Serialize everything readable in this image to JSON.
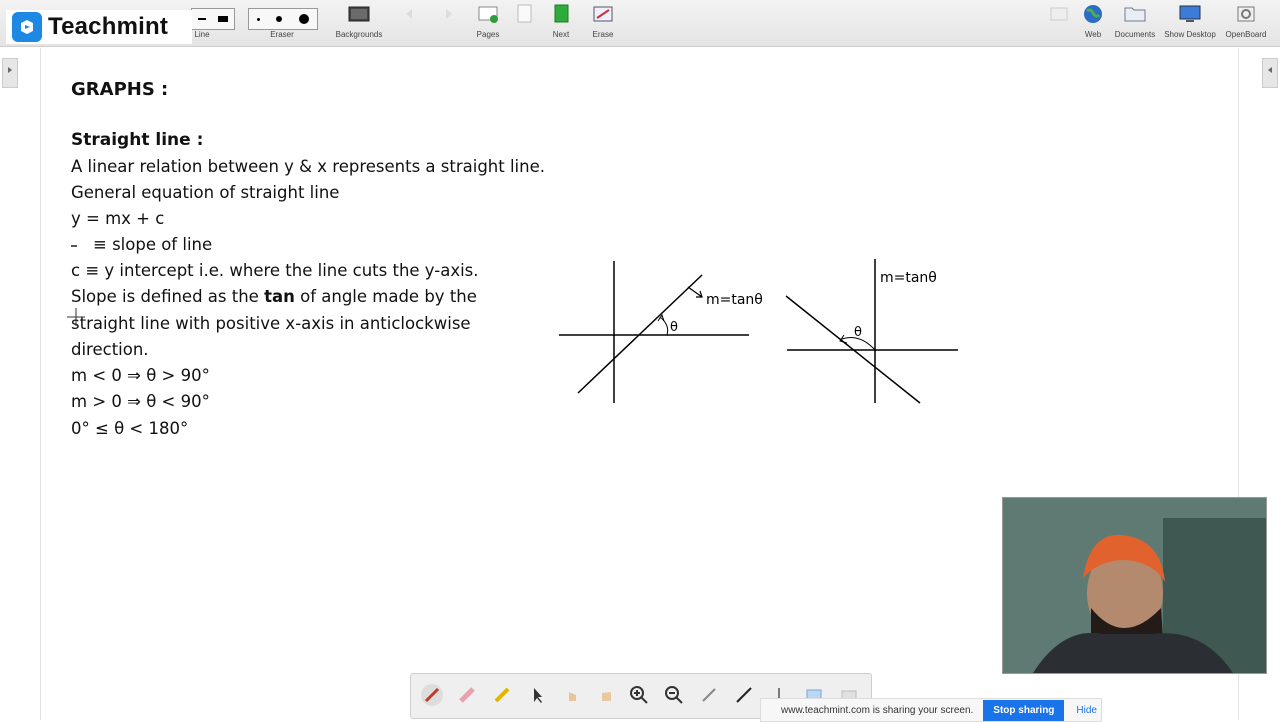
{
  "brand": {
    "name": "Teachmint"
  },
  "toolbar": {
    "line_label": "Line",
    "eraser_label": "Eraser",
    "backgrounds_label": "Backgrounds",
    "pages_label": "Pages",
    "next_label": "Next",
    "erase_label": "Erase",
    "web_label": "Web",
    "documents_label": "Documents",
    "show_desktop_label": "Show Desktop",
    "openboard_label": "OpenBoard"
  },
  "notes": {
    "heading": "GRAPHS  :",
    "subheading": "Straight line :",
    "line1": "A linear relation between y & x represents a straight line.",
    "line2": "General equation of straight line",
    "line3": "y = mx + c",
    "line4": "≡ slope of line",
    "line5": "c ≡ y intercept i.e. where the line cuts the y-axis.",
    "line6_a": "Slope is defined as the ",
    "line6_b": "tan",
    "line6_c": " of  angle made by the",
    "line7": "straight line with positive x-axis in anticlockwise",
    "line8": "direction.",
    "line9": "m < 0  ⇒  θ > 90°",
    "line10": "m > 0  ⇒ θ < 90°",
    "line11": "0° ≤ θ < 180°"
  },
  "graph1": {
    "label": "m=tanθ",
    "angle": "θ"
  },
  "graph2": {
    "label": "m=tanθ",
    "angle": "θ"
  },
  "share": {
    "text": "www.teachmint.com is sharing your screen.",
    "stop_label": "Stop sharing",
    "hide_label": "Hide"
  },
  "colors": {
    "brand": "#1e88e5",
    "stop_button": "#1a73e8"
  }
}
